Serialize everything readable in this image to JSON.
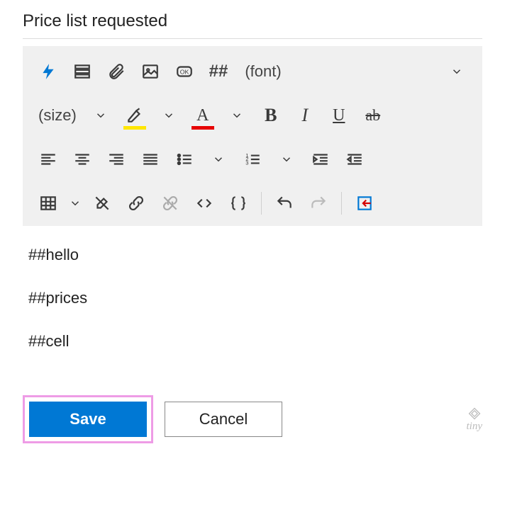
{
  "title": "Price list requested",
  "toolbar": {
    "placeholder_label": "##",
    "font_label": "(font)",
    "size_label": "(size)",
    "highlight_color": "#ffe600",
    "font_color": "#e60000"
  },
  "editor": {
    "lines": [
      "##hello",
      "##prices",
      "##cell"
    ]
  },
  "buttons": {
    "save": "Save",
    "cancel": "Cancel"
  },
  "branding": "tiny"
}
